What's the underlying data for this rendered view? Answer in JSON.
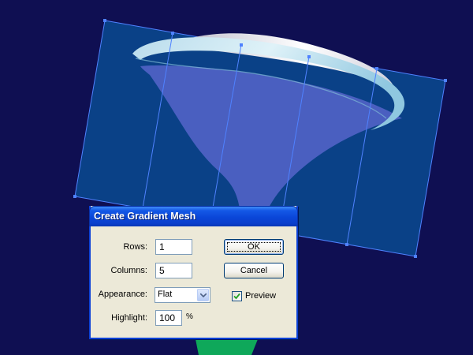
{
  "dialog": {
    "title": "Create Gradient Mesh",
    "rows": {
      "label": "Rows:",
      "value": "1"
    },
    "columns": {
      "label": "Columns:",
      "value": "5"
    },
    "appearance": {
      "label": "Appearance:",
      "value": "Flat"
    },
    "highlight": {
      "label": "Highlight:",
      "value": "100",
      "unit": "%"
    },
    "ok_label": "OK",
    "cancel_label": "Cancel",
    "preview": {
      "label": "Preview",
      "checked": true
    }
  },
  "colors": {
    "canvas_background": "#0f0f52",
    "mesh_fill": "#0a4187",
    "mesh_lines": "#4f82ff",
    "funnel_fill": "#4a5fc0",
    "stem_fill": "#0fa85a",
    "dialog_title_bar": "#0a46d8",
    "dialog_body": "#ece9d8"
  }
}
